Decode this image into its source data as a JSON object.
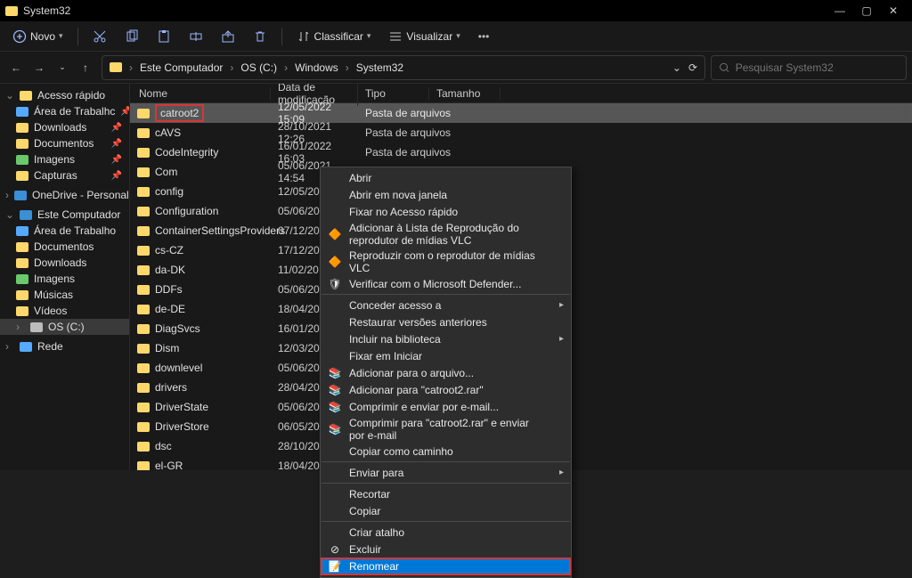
{
  "window": {
    "title": "System32",
    "minimize": "—",
    "maximize": "▢",
    "close": "✕"
  },
  "toolbar": {
    "new_label": "Novo",
    "sort_label": "Classificar",
    "view_label": "Visualizar",
    "more": "•••"
  },
  "breadcrumb": {
    "segments": [
      "Este Computador",
      "OS (C:)",
      "Windows",
      "System32"
    ],
    "chevron_down": "⌄",
    "refresh": "⟳"
  },
  "search": {
    "placeholder": "Pesquisar System32"
  },
  "sidebar": {
    "quick_access": {
      "label": "Acesso rápido",
      "items": [
        {
          "label": "Área de Trabalhc",
          "icon": "ico-blue"
        },
        {
          "label": "Downloads",
          "icon": "ico-folder"
        },
        {
          "label": "Documentos",
          "icon": "ico-folder"
        },
        {
          "label": "Imagens",
          "icon": "ico-green"
        },
        {
          "label": "Capturas",
          "icon": "ico-folder"
        }
      ]
    },
    "onedrive": {
      "label": "OneDrive - Personal"
    },
    "this_pc": {
      "label": "Este Computador",
      "items": [
        {
          "label": "Área de Trabalho",
          "icon": "ico-blue"
        },
        {
          "label": "Documentos",
          "icon": "ico-folder"
        },
        {
          "label": "Downloads",
          "icon": "ico-folder"
        },
        {
          "label": "Imagens",
          "icon": "ico-green"
        },
        {
          "label": "Músicas",
          "icon": "ico-folder"
        },
        {
          "label": "Vídeos",
          "icon": "ico-folder"
        },
        {
          "label": "OS (C:)",
          "icon": "ico-drive"
        }
      ]
    },
    "network": {
      "label": "Rede"
    }
  },
  "columns": {
    "name": "Nome",
    "date": "Data de modificação",
    "type": "Tipo",
    "size": "Tamanho"
  },
  "files": [
    {
      "name": "catroot2",
      "date": "12/05/2022 15:09",
      "type": "Pasta de arquivos",
      "selected": true,
      "highlighted": true
    },
    {
      "name": "cAVS",
      "date": "28/10/2021 12:26",
      "type": "Pasta de arquivos"
    },
    {
      "name": "CodeIntegrity",
      "date": "16/01/2022 16:03",
      "type": "Pasta de arquivos"
    },
    {
      "name": "Com",
      "date": "05/06/2021 14:54",
      "type": "Pasta de arquivos"
    },
    {
      "name": "config",
      "date": "12/05/20",
      "type": ""
    },
    {
      "name": "Configuration",
      "date": "05/06/20",
      "type": ""
    },
    {
      "name": "ContainerSettingsProviders",
      "date": "07/12/20",
      "type": ""
    },
    {
      "name": "cs-CZ",
      "date": "17/12/20",
      "type": ""
    },
    {
      "name": "da-DK",
      "date": "11/02/20",
      "type": ""
    },
    {
      "name": "DDFs",
      "date": "05/06/20",
      "type": ""
    },
    {
      "name": "de-DE",
      "date": "18/04/20",
      "type": ""
    },
    {
      "name": "DiagSvcs",
      "date": "16/01/20",
      "type": ""
    },
    {
      "name": "Dism",
      "date": "12/03/20",
      "type": ""
    },
    {
      "name": "downlevel",
      "date": "05/06/20",
      "type": ""
    },
    {
      "name": "drivers",
      "date": "28/04/20",
      "type": ""
    },
    {
      "name": "DriverState",
      "date": "05/06/20",
      "type": ""
    },
    {
      "name": "DriverStore",
      "date": "06/05/20",
      "type": ""
    },
    {
      "name": "dsc",
      "date": "28/10/20",
      "type": ""
    },
    {
      "name": "el-GR",
      "date": "18/04/20",
      "type": ""
    }
  ],
  "context_menu": {
    "open": "Abrir",
    "open_new_window": "Abrir em nova janela",
    "pin_quick_access": "Fixar no Acesso rápido",
    "vlc_playlist": "Adicionar à Lista de Reprodução do reprodutor de mídias VLC",
    "vlc_play": "Reproduzir com o reprodutor de mídias VLC",
    "defender": "Verificar com o Microsoft Defender...",
    "grant_access": "Conceder acesso a",
    "restore_versions": "Restaurar versões anteriores",
    "include_library": "Incluir na biblioteca",
    "pin_start": "Fixar em Iniciar",
    "add_archive": "Adicionar para o arquivo...",
    "add_catroot_rar": "Adicionar para \"catroot2.rar\"",
    "compress_email": "Comprimir e enviar por e-mail...",
    "compress_catroot_email": "Comprimir para \"catroot2.rar\" e enviar por e-mail",
    "copy_path": "Copiar como caminho",
    "send_to": "Enviar para",
    "cut": "Recortar",
    "copy": "Copiar",
    "create_shortcut": "Criar atalho",
    "delete": "Excluir",
    "rename": "Renomear"
  }
}
